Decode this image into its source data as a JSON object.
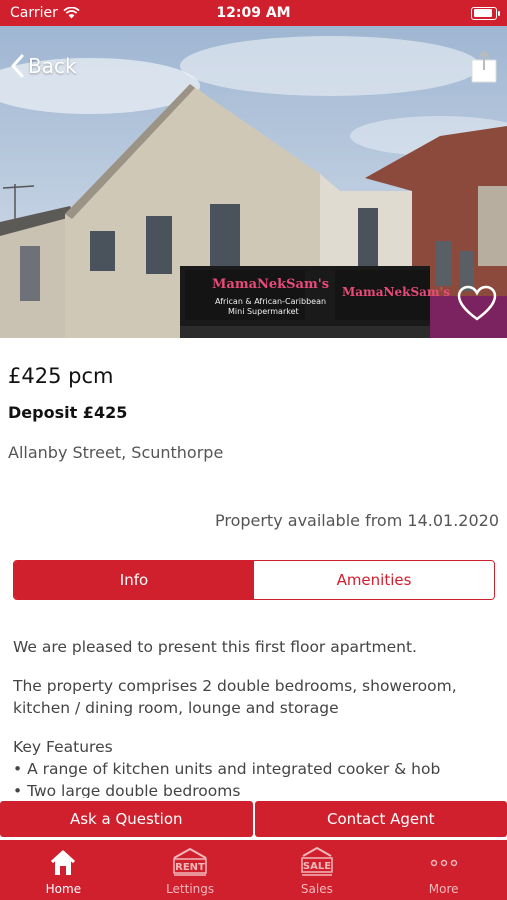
{
  "status_bar": {
    "carrier": "Carrier",
    "time": "12:09 AM"
  },
  "nav": {
    "back_label": "Back"
  },
  "hero": {
    "shop_sign": "MamaNekSam's",
    "shop_sub_1": "African & African-Caribbean",
    "shop_sub_2": "Mini Supermarket"
  },
  "listing": {
    "price": "£425 pcm",
    "deposit": "Deposit £425",
    "address": "Allanby Street, Scunthorpe",
    "availability": "Property available from 14.01.2020"
  },
  "tabs": [
    {
      "label": "Info"
    },
    {
      "label": "Amenities"
    }
  ],
  "info": {
    "intro": "We are pleased to present this first floor apartment.",
    "description": "The property comprises 2 double bedrooms, showeroom, kitchen / dining room, lounge and storage",
    "features_heading": "Key Features",
    "features": [
      "• A range of kitchen units and integrated cooker & hob",
      "• Two large double bedrooms"
    ]
  },
  "actions": {
    "ask": "Ask a Question",
    "contact": "Contact Agent"
  },
  "tab_bar": {
    "home": "Home",
    "lettings": "Lettings",
    "lettings_sign": "RENT",
    "sales": "Sales",
    "sales_sign": "SALE",
    "more": "More"
  },
  "colors": {
    "brand_red": "#d0202d"
  }
}
